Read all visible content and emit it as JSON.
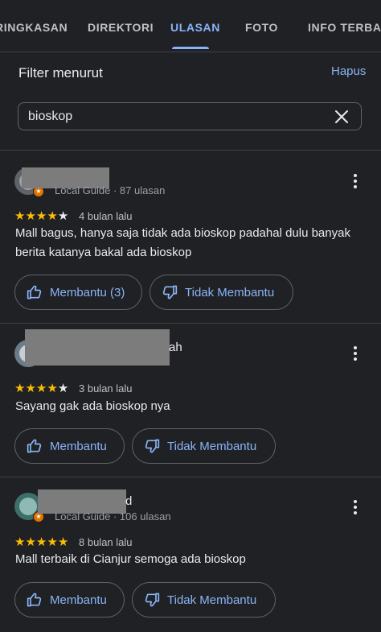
{
  "tabs": [
    {
      "label": "RINGKASAN"
    },
    {
      "label": "DIREKTORI"
    },
    {
      "label": "ULASAN"
    },
    {
      "label": "FOTO"
    },
    {
      "label": "INFO TERBARU"
    }
  ],
  "filter": {
    "title": "Filter menurut",
    "clear_label": "Hapus",
    "search_value": "bioskop"
  },
  "reviews": [
    {
      "author_visible_suffix": "",
      "meta": "Local Guide · 87 ulasan",
      "rating": 4,
      "date": "4 bulan lalu",
      "text": "Mall bagus, hanya saja tidak ada bioskop padahal dulu banyak berita katanya bakal ada bioskop",
      "helpful_label": "Membantu (3)",
      "not_helpful_label": "Tidak Membantu"
    },
    {
      "author_visible_suffix": "ah",
      "meta": "",
      "rating": 4,
      "date": "3 bulan lalu",
      "text": "Sayang gak ada bioskop nya",
      "helpful_label": "Membantu",
      "not_helpful_label": "Tidak Membantu"
    },
    {
      "author_visible_suffix": "d",
      "meta": "Local Guide · 106 ulasan",
      "rating": 5,
      "date": "8 bulan lalu",
      "text": "Mall terbaik di Cianjur semoga ada bioskop",
      "helpful_label": "Membantu",
      "not_helpful_label": "Tidak Membantu"
    }
  ],
  "colors": {
    "background": "#202124",
    "accent": "#8ab4f8",
    "star": "#fbbc04",
    "divider": "#3c4043"
  }
}
